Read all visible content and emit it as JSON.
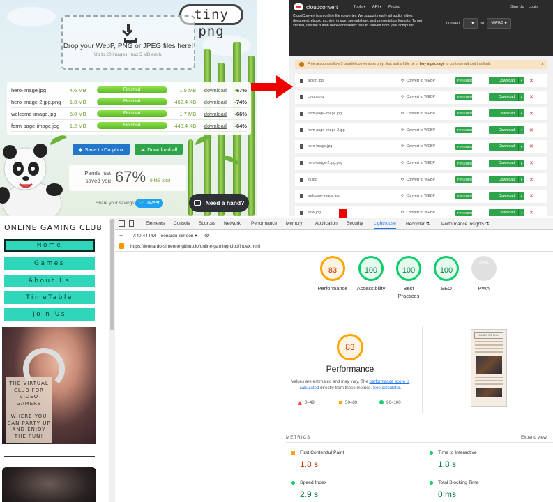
{
  "tinypng": {
    "logo": "tiny png",
    "drop_title": "Drop your WebP, PNG or JPEG files here!",
    "drop_sub": "Up to 20 images, max 5 MB each.",
    "files": [
      {
        "name": "hero-image.jpg",
        "size": "4.6 MB",
        "status": "Finished",
        "new_size": "1.5 MB",
        "link": "download",
        "saved": "-67%",
        "progress": 1.0
      },
      {
        "name": "hero-image-2.jpg.png",
        "size": "1.8 MB",
        "status": "Finished",
        "new_size": "462.4 KB",
        "link": "download",
        "saved": "-74%",
        "progress": 1.0
      },
      {
        "name": "welcome-image.jpg",
        "size": "5.0 MB",
        "status": "Finished",
        "new_size": "1.7 MB",
        "link": "download",
        "saved": "-66%",
        "progress": 1.0
      },
      {
        "name": "form-page-image.jpg",
        "size": "1.2 MB",
        "status": "Finished",
        "new_size": "448.4 KB",
        "link": "download",
        "saved": "-64%",
        "progress": 1.0
      }
    ],
    "save_dropbox": "Save to Dropbox",
    "download_all": "Download all",
    "panda_saved": "Panda just saved you",
    "percent": "67%",
    "total": "9 MB total",
    "share": "Share your savings",
    "tweet": "Tweet",
    "help": "Need a hand?"
  },
  "cloudconvert": {
    "logo": "cloudconvert",
    "nav": [
      "Tools ▾",
      "API ▾",
      "Pricing",
      "Sign Up",
      "Login"
    ],
    "description": "CloudConvert is an online file converter. We support nearly all audio, video, document, ebook, archive, image, spreadsheet, and presentation formats. To get started, use the button below and select files to convert from your computer.",
    "convert_label": "convert",
    "from_value": "... ▾",
    "to_label": "to",
    "to_value": "WEBP ▾",
    "notice_a": "Free accounts allow 5 parallel conversions only. Just wait a little bit or ",
    "notice_b": "buy a package",
    "notice_c": " to continue without this limit.",
    "notice_close": "×",
    "convert_to": "Convert to WEBP",
    "finished": "FINISHED",
    "download": "Download",
    "files": [
      "albion.jpg",
      "cs-go.png",
      "form-page-image.jpg",
      "form-page-image-2.jpg",
      "hero-image.jpg",
      "hero-image-2.jpg.png",
      "lol.jpg",
      "welcome-image.jpg",
      "wow.jpg"
    ]
  },
  "gaming_club": {
    "title": "ONLINE GAMING CLUB",
    "nav": [
      "Home",
      "Games",
      "About Us",
      "TimeTable",
      "Join Us"
    ],
    "active_index": 0,
    "hero_text_1": "THE VIRTUAL CLUB FOR VIDEO GAMERS",
    "hero_text_2": "WHERE YOU CAN PARTY UP AND ENJOY THE FUN!"
  },
  "devtools": {
    "tabs": [
      "Elements",
      "Console",
      "Sources",
      "Network",
      "Performance",
      "Memory",
      "Application",
      "Security",
      "Lighthouse",
      "Recorder ⚗",
      "Performance insights ⚗"
    ],
    "active_tab": "Lighthouse",
    "report_time": "7:40:44 PM - leonardo-simeon ▾",
    "url": "https://leonardo-simeone.github.io/online-gaming-club/index.html",
    "scores": [
      {
        "label": "Performance",
        "value": "83",
        "level": "orange"
      },
      {
        "label": "Accessibility",
        "value": "100",
        "level": "green"
      },
      {
        "label": "Best Practices",
        "value": "100",
        "level": "green"
      },
      {
        "label": "SEO",
        "value": "100",
        "level": "green"
      },
      {
        "label": "PWA",
        "value": "PWA",
        "level": "grey"
      }
    ],
    "perf_score": "83",
    "perf_title": "Performance",
    "perf_desc_1": "Values are estimated and may vary. The ",
    "perf_desc_link1": "performance score is calculated",
    "perf_desc_2": " directly from these metrics. ",
    "perf_desc_link2": "See calculator.",
    "legend": [
      "0–49",
      "50–89",
      "90–100"
    ],
    "thumb_header": "GAMES WE PLAY",
    "metrics_heading": "METRICS",
    "expand_view": "Expand view",
    "metrics": [
      {
        "name": "First Contentful Paint",
        "value": "1.8 s",
        "level": "orange"
      },
      {
        "name": "Time to Interactive",
        "value": "1.8 s",
        "level": "green"
      },
      {
        "name": "Speed Index",
        "value": "2.9 s",
        "level": "green"
      },
      {
        "name": "Total Blocking Time",
        "value": "0 ms",
        "level": "green"
      }
    ]
  },
  "colors": {
    "tinypng_green": "#5cb82a",
    "cc_green": "#2ea54a",
    "teal_nav": "#2fd6b9",
    "arrow_red": "#ee0000",
    "lh_green": "#0cce6b",
    "lh_orange": "#ffa400"
  }
}
